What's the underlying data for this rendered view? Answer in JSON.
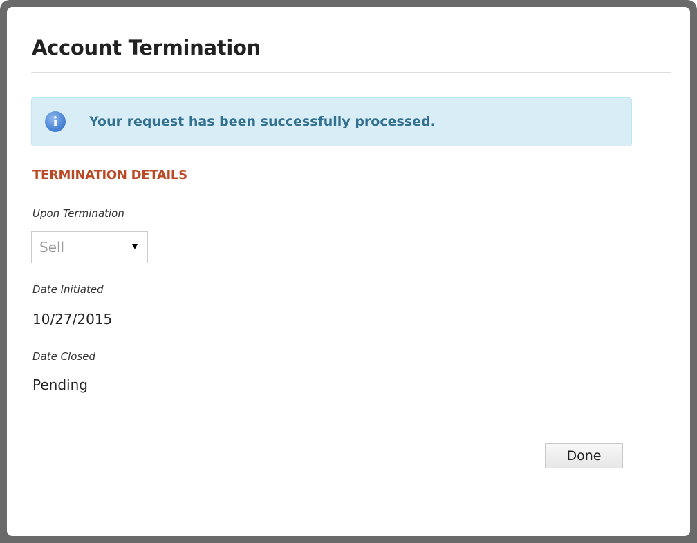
{
  "dialog": {
    "title": "Account Termination",
    "alert": {
      "icon": "info-icon",
      "icon_glyph": "i",
      "message": "Your request has been successfully processed."
    },
    "section_heading": "TERMINATION DETAILS",
    "fields": {
      "upon_termination": {
        "label": "Upon Termination",
        "selected": "Sell"
      },
      "date_initiated": {
        "label": "Date Initiated",
        "value": "10/27/2015"
      },
      "date_closed": {
        "label": "Date Closed",
        "value": "Pending"
      }
    },
    "done_label": "Done"
  },
  "colors": {
    "frame": "#6a6a6a",
    "alert_bg": "#d9edf7",
    "alert_text": "#31708f",
    "section_heading": "#b94a25"
  }
}
